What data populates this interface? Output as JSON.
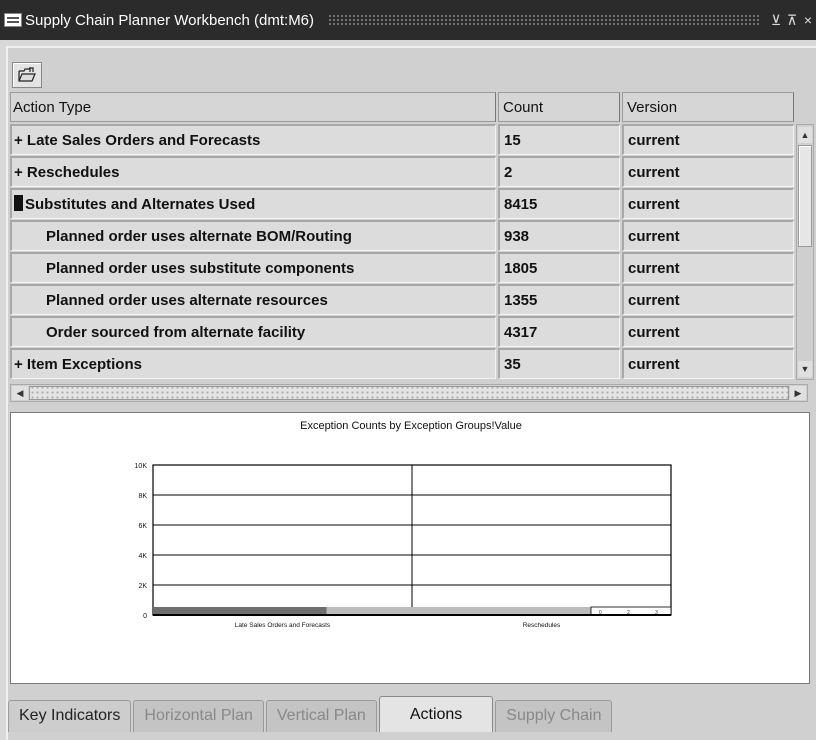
{
  "window": {
    "title": "Supply Chain Planner Workbench (dmt:M6)",
    "min_glyph": "⊻",
    "max_glyph": "⊼",
    "close_glyph": "×"
  },
  "toolbar": {
    "icon": "open-folder-icon"
  },
  "table": {
    "headers": {
      "action_type": "Action Type",
      "count": "Count",
      "version": "Version"
    },
    "rows": [
      {
        "label": "+ Late Sales Orders and Forecasts",
        "count": "15",
        "version": "current"
      },
      {
        "label": "+ Reschedules",
        "count": "2",
        "version": "current"
      },
      {
        "label": "Substitutes and Alternates Used",
        "count": "8415",
        "version": "current"
      },
      {
        "label": "Planned order uses alternate BOM/Routing",
        "count": "938",
        "version": "current"
      },
      {
        "label": "Planned order uses substitute components",
        "count": "1805",
        "version": "current"
      },
      {
        "label": "Planned order uses alternate resources",
        "count": "1355",
        "version": "current"
      },
      {
        "label": "Order sourced from alternate facility",
        "count": "4317",
        "version": "current"
      },
      {
        "label": "+ Item Exceptions",
        "count": "35",
        "version": "current"
      }
    ]
  },
  "chart_data": {
    "type": "bar",
    "title": "Exception Counts by Exception Groups!Value",
    "categories": [
      "Late Sales Orders and Forecasts",
      "Reschedules"
    ],
    "values": [
      15,
      2
    ],
    "yticks": [
      "0",
      "2K",
      "4K",
      "6K",
      "8K",
      "10K"
    ],
    "ylim": [
      0,
      10000
    ],
    "inset_ticks": [
      "0",
      "2",
      "3"
    ],
    "colors": {
      "bar_dark": "#6e6e6e",
      "bar_light": "#bcbcbc"
    },
    "grid": true
  },
  "tabs": [
    {
      "label": "Key Indicators"
    },
    {
      "label": "Horizontal Plan"
    },
    {
      "label": "Vertical Plan"
    },
    {
      "label": "Actions"
    },
    {
      "label": "Supply Chain"
    }
  ]
}
